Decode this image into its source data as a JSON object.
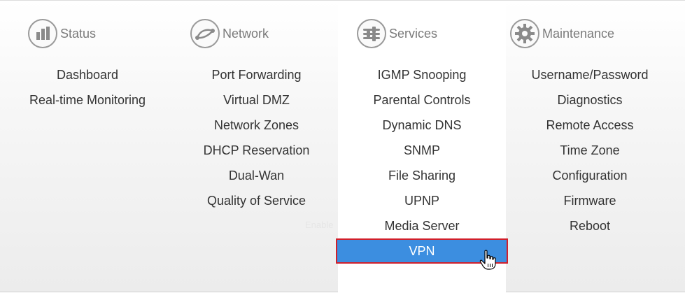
{
  "columns": [
    {
      "title": "Status",
      "icon": "bar-chart-icon",
      "items": [
        "Dashboard",
        "Real-time Monitoring"
      ]
    },
    {
      "title": "Network",
      "icon": "network-link-icon",
      "items": [
        "Port Forwarding",
        "Virtual DMZ",
        "Network Zones",
        "DHCP Reservation",
        "Dual-Wan",
        "Quality of Service"
      ]
    },
    {
      "title": "Services",
      "icon": "sliders-icon",
      "items": [
        "IGMP Snooping",
        "Parental Controls",
        "Dynamic DNS",
        "SNMP",
        "File Sharing",
        "UPNP",
        "Media Server",
        "VPN"
      ],
      "selected_item": "VPN"
    },
    {
      "title": "Maintenance",
      "icon": "gear-icon",
      "items": [
        "Username/Password",
        "Diagnostics",
        "Remote Access",
        "Time Zone",
        "Configuration",
        "Firmware",
        "Reboot"
      ]
    }
  ],
  "ghost_text": "Enable",
  "colors": {
    "selected_bg": "#3c8ee0",
    "selected_border": "#d11f2b",
    "text": "#333333",
    "header_text": "#7a7a7a"
  },
  "cursor_icon": "hand-pointer-icon"
}
